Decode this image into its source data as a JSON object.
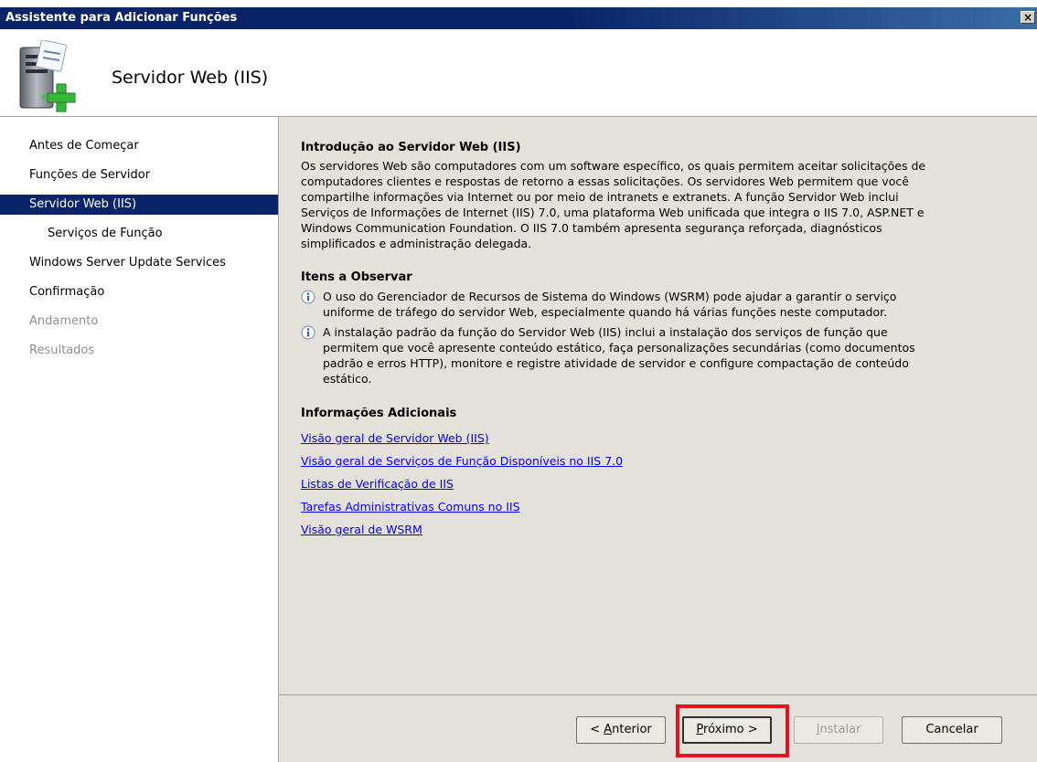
{
  "window": {
    "title": "Assistente para Adicionar Funções",
    "close_glyph": "×"
  },
  "header": {
    "title": "Servidor Web (IIS)",
    "icon": "server-add-icon"
  },
  "nav": [
    {
      "label": "Antes de Começar",
      "state": "normal"
    },
    {
      "label": "Funções de Servidor",
      "state": "normal"
    },
    {
      "label": "Servidor Web (IIS)",
      "state": "selected"
    },
    {
      "label": "Serviços de Função",
      "state": "sub"
    },
    {
      "label": "Windows Server Update Services",
      "state": "normal"
    },
    {
      "label": "Confirmação",
      "state": "normal"
    },
    {
      "label": "Andamento",
      "state": "disabled"
    },
    {
      "label": "Resultados",
      "state": "disabled"
    }
  ],
  "intro": {
    "heading": "Introdução ao Servidor Web (IIS)",
    "lines": [
      "Os servidores Web são computadores com um software específico, os quais permitem aceitar solicitações de",
      "computadores clientes e respostas de retorno a essas solicitações. Os servidores Web permitem que você",
      "compartilhe informações via Internet ou por meio de intranets e extranets. A função Servidor Web inclui",
      "Serviços de Informações de Internet (IIS) 7.0, uma plataforma Web unificada que integra o IIS 7.0, ASP.NET e",
      "Windows Communication Foundation. O IIS 7.0 também apresenta segurança reforçada, diagnósticos",
      "simplificados e administração delegada."
    ]
  },
  "notes": {
    "heading": "Itens a Observar",
    "items": [
      [
        "O uso do Gerenciador de Recursos de Sistema do Windows (WSRM) pode ajudar a garantir o serviço",
        "uniforme de tráfego do servidor Web, especialmente quando há várias funções neste computador."
      ],
      [
        "A instalação padrão da função do Servidor Web (IIS) inclui a instalação dos serviços de função que",
        "permitem que você apresente conteúdo estático, faça personalizações secundárias (como documentos",
        "padrão e erros HTTP), monitore e registre atividade de servidor e configure compactação de conteúdo",
        "estático."
      ]
    ]
  },
  "more_info": {
    "heading": "Informações Adicionais",
    "links": [
      "Visão geral de Servidor Web (IIS)",
      "Visão geral de Serviços de Função Disponíveis no IIS 7.0",
      "Listas de Verificação de IIS",
      "Tarefas Administrativas Comuns no IIS",
      "Visão geral de WSRM"
    ]
  },
  "buttons": {
    "back": {
      "prefix": "< ",
      "mnemonic": "A",
      "rest": "nterior"
    },
    "next": {
      "mnemonic": "P",
      "rest": "róximo >"
    },
    "install": {
      "mnemonic": "I",
      "rest": "nstalar"
    },
    "cancel": {
      "label": "Cancelar"
    }
  },
  "colors": {
    "title_bar": "#0a246a",
    "selection": "#0a246a",
    "content_bg": "#e4e1da",
    "highlight": "#e8101a",
    "link": "#0000ff"
  }
}
